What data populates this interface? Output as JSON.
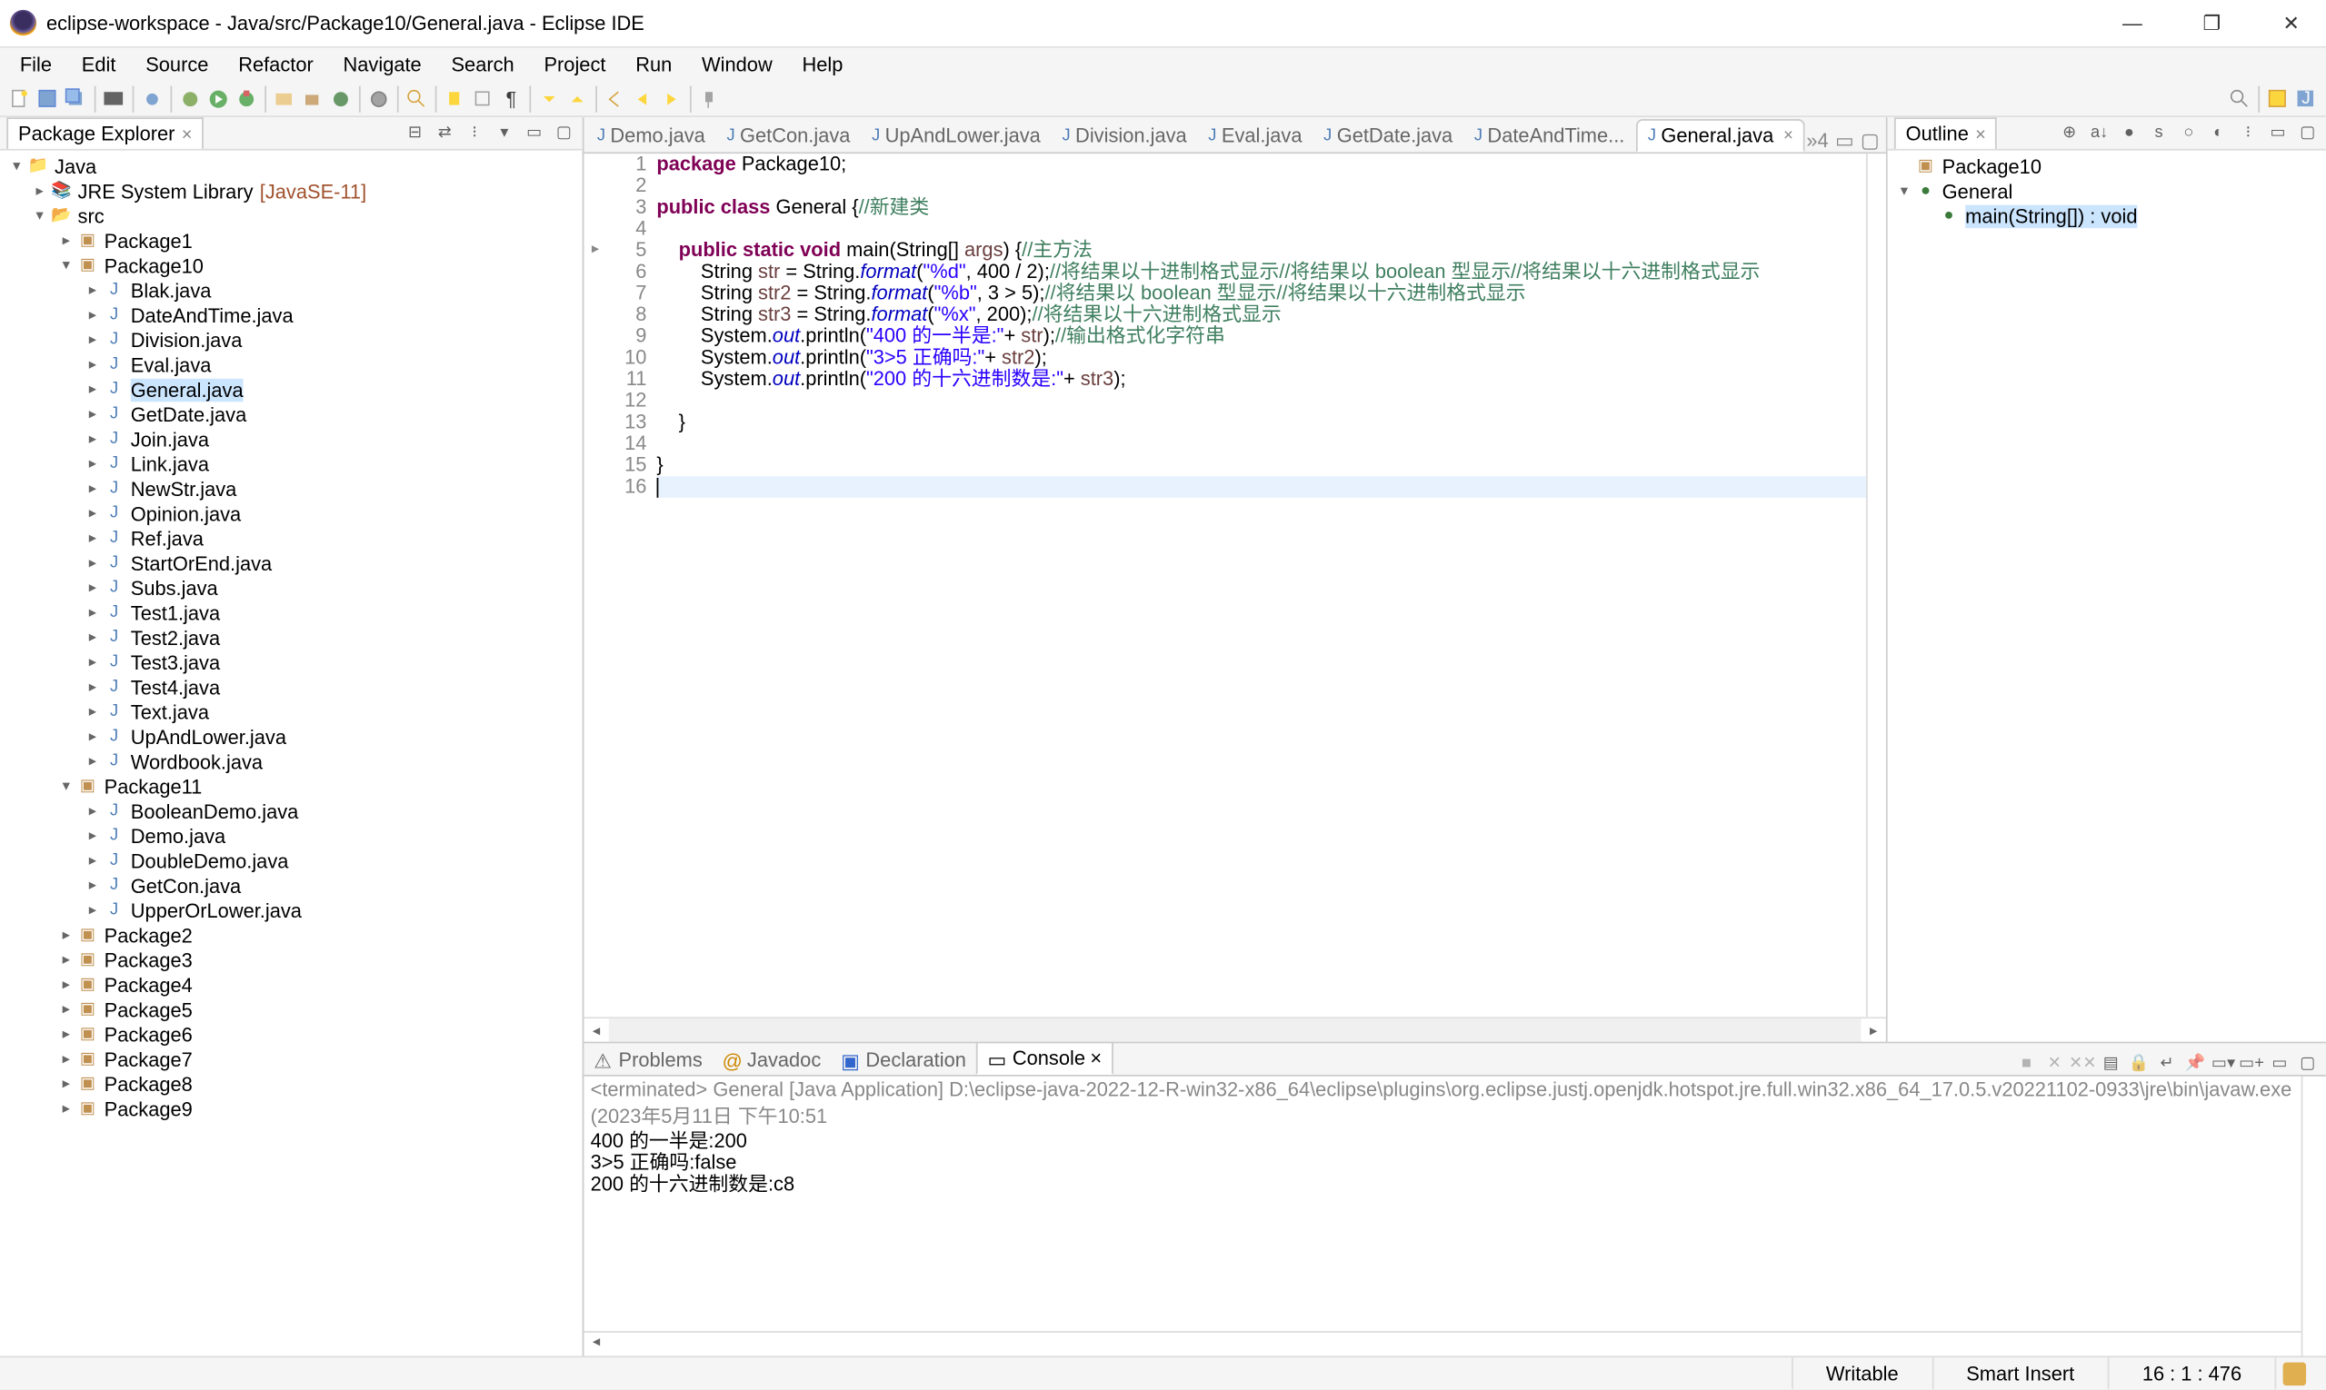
{
  "window": {
    "title": "eclipse-workspace - Java/src/Package10/General.java - Eclipse IDE"
  },
  "menu": [
    "File",
    "Edit",
    "Source",
    "Refactor",
    "Navigate",
    "Search",
    "Project",
    "Run",
    "Window",
    "Help"
  ],
  "pkgExplorer": {
    "title": "Package Explorer",
    "project": "Java",
    "jre": "JRE System Library",
    "jreDecor": "[JavaSE-11]",
    "srcFolder": "src",
    "packages": [
      {
        "name": "Package1",
        "expanded": false
      },
      {
        "name": "Package10",
        "expanded": true,
        "files": [
          "Blak.java",
          "DateAndTime.java",
          "Division.java",
          "Eval.java",
          "General.java",
          "GetDate.java",
          "Join.java",
          "Link.java",
          "NewStr.java",
          "Opinion.java",
          "Ref.java",
          "StartOrEnd.java",
          "Subs.java",
          "Test1.java",
          "Test2.java",
          "Test3.java",
          "Test4.java",
          "Text.java",
          "UpAndLower.java",
          "Wordbook.java"
        ]
      },
      {
        "name": "Package11",
        "expanded": true,
        "files": [
          "BooleanDemo.java",
          "Demo.java",
          "DoubleDemo.java",
          "GetCon.java",
          "UpperOrLower.java"
        ]
      },
      {
        "name": "Package2",
        "expanded": false
      },
      {
        "name": "Package3",
        "expanded": false
      },
      {
        "name": "Package4",
        "expanded": false
      },
      {
        "name": "Package5",
        "expanded": false
      },
      {
        "name": "Package6",
        "expanded": false
      },
      {
        "name": "Package7",
        "expanded": false
      },
      {
        "name": "Package8",
        "expanded": false
      },
      {
        "name": "Package9",
        "expanded": false
      }
    ],
    "selectedFile": "General.java"
  },
  "editorTabs": [
    "Demo.java",
    "GetCon.java",
    "UpAndLower.java",
    "Division.java",
    "Eval.java",
    "GetDate.java",
    "DateAndTime...",
    "General.java"
  ],
  "activeTab": "General.java",
  "tabOverflow": "»4",
  "code": {
    "lines": [
      {
        "n": 1,
        "type": "code",
        "segments": [
          [
            "kw",
            "package"
          ],
          [
            "",
            " Package10;"
          ]
        ]
      },
      {
        "n": 2,
        "type": "blank"
      },
      {
        "n": 3,
        "type": "code",
        "segments": [
          [
            "kw",
            "public class"
          ],
          [
            "",
            " "
          ],
          [
            "typ",
            "General"
          ],
          [
            "",
            " {"
          ],
          [
            "cmt",
            "//新建类"
          ]
        ]
      },
      {
        "n": 4,
        "type": "blank"
      },
      {
        "n": "5▸",
        "type": "code",
        "segments": [
          [
            "",
            "    "
          ],
          [
            "kw",
            "public static void"
          ],
          [
            "",
            " main(String[] "
          ],
          [
            "var",
            "args"
          ],
          [
            "",
            ") {"
          ],
          [
            "cmt",
            "//主方法"
          ]
        ]
      },
      {
        "n": 6,
        "type": "code",
        "segments": [
          [
            "",
            "        String "
          ],
          [
            "var",
            "str"
          ],
          [
            "",
            " = String."
          ],
          [
            "sf f",
            "format"
          ],
          [
            "",
            "("
          ],
          [
            "str",
            "\"%d\""
          ],
          [
            "",
            ", 400 / 2);"
          ],
          [
            "cmt",
            "//将结果以十进制格式显示//将结果以 boolean 型显示//将结果以十六进制格式显示"
          ]
        ]
      },
      {
        "n": 7,
        "type": "code",
        "segments": [
          [
            "",
            "        String "
          ],
          [
            "var",
            "str2"
          ],
          [
            "",
            " = String."
          ],
          [
            "sf f",
            "format"
          ],
          [
            "",
            "("
          ],
          [
            "str",
            "\"%b\""
          ],
          [
            "",
            ", 3 > 5);"
          ],
          [
            "cmt",
            "//将结果以 boolean 型显示//将结果以十六进制格式显示"
          ]
        ]
      },
      {
        "n": 8,
        "type": "code",
        "segments": [
          [
            "",
            "        String "
          ],
          [
            "var",
            "str3"
          ],
          [
            "",
            " = String."
          ],
          [
            "sf f",
            "format"
          ],
          [
            "",
            "("
          ],
          [
            "str",
            "\"%x\""
          ],
          [
            "",
            ", 200);"
          ],
          [
            "cmt",
            "//将结果以十六进制格式显示"
          ]
        ]
      },
      {
        "n": 9,
        "type": "code",
        "segments": [
          [
            "",
            "        System."
          ],
          [
            "sf",
            "out"
          ],
          [
            "",
            ".println("
          ],
          [
            "str",
            "\"400 的一半是:\""
          ],
          [
            "",
            "+ "
          ],
          [
            "var",
            "str"
          ],
          [
            "",
            ");"
          ],
          [
            "cmt",
            "//输出格式化字符串"
          ]
        ]
      },
      {
        "n": 10,
        "type": "code",
        "segments": [
          [
            "",
            "        System."
          ],
          [
            "sf",
            "out"
          ],
          [
            "",
            ".println("
          ],
          [
            "str",
            "\"3>5 正确吗:\""
          ],
          [
            "",
            "+ "
          ],
          [
            "var",
            "str2"
          ],
          [
            "",
            ");"
          ]
        ]
      },
      {
        "n": 11,
        "type": "code",
        "segments": [
          [
            "",
            "        System."
          ],
          [
            "sf",
            "out"
          ],
          [
            "",
            ".println("
          ],
          [
            "str",
            "\"200 的十六进制数是:\""
          ],
          [
            "",
            "+ "
          ],
          [
            "var",
            "str3"
          ],
          [
            "",
            ");"
          ]
        ]
      },
      {
        "n": 12,
        "type": "blank"
      },
      {
        "n": 13,
        "type": "code",
        "segments": [
          [
            "",
            "    }"
          ]
        ]
      },
      {
        "n": 14,
        "type": "blank"
      },
      {
        "n": 15,
        "type": "code",
        "segments": [
          [
            "",
            "}"
          ]
        ]
      },
      {
        "n": 16,
        "type": "current",
        "segments": [
          [
            "",
            ""
          ]
        ]
      }
    ]
  },
  "outline": {
    "title": "Outline",
    "pkg": "Package10",
    "class": "General",
    "method": "main(String[]) : void"
  },
  "bottomTabs": [
    "Problems",
    "Javadoc",
    "Declaration",
    "Console"
  ],
  "activeBottomTab": "Console",
  "console": {
    "header": "<terminated> General [Java Application] D:\\eclipse-java-2022-12-R-win32-x86_64\\eclipse\\plugins\\org.eclipse.justj.openjdk.hotspot.jre.full.win32.x86_64_17.0.5.v20221102-0933\\jre\\bin\\javaw.exe  (2023年5月11日 下午10:51",
    "lines": [
      "400 的一半是:200",
      "3>5 正确吗:false",
      "200 的十六进制数是:c8"
    ]
  },
  "status": {
    "writable": "Writable",
    "insert": "Smart Insert",
    "pos": "16 : 1 : 476"
  }
}
